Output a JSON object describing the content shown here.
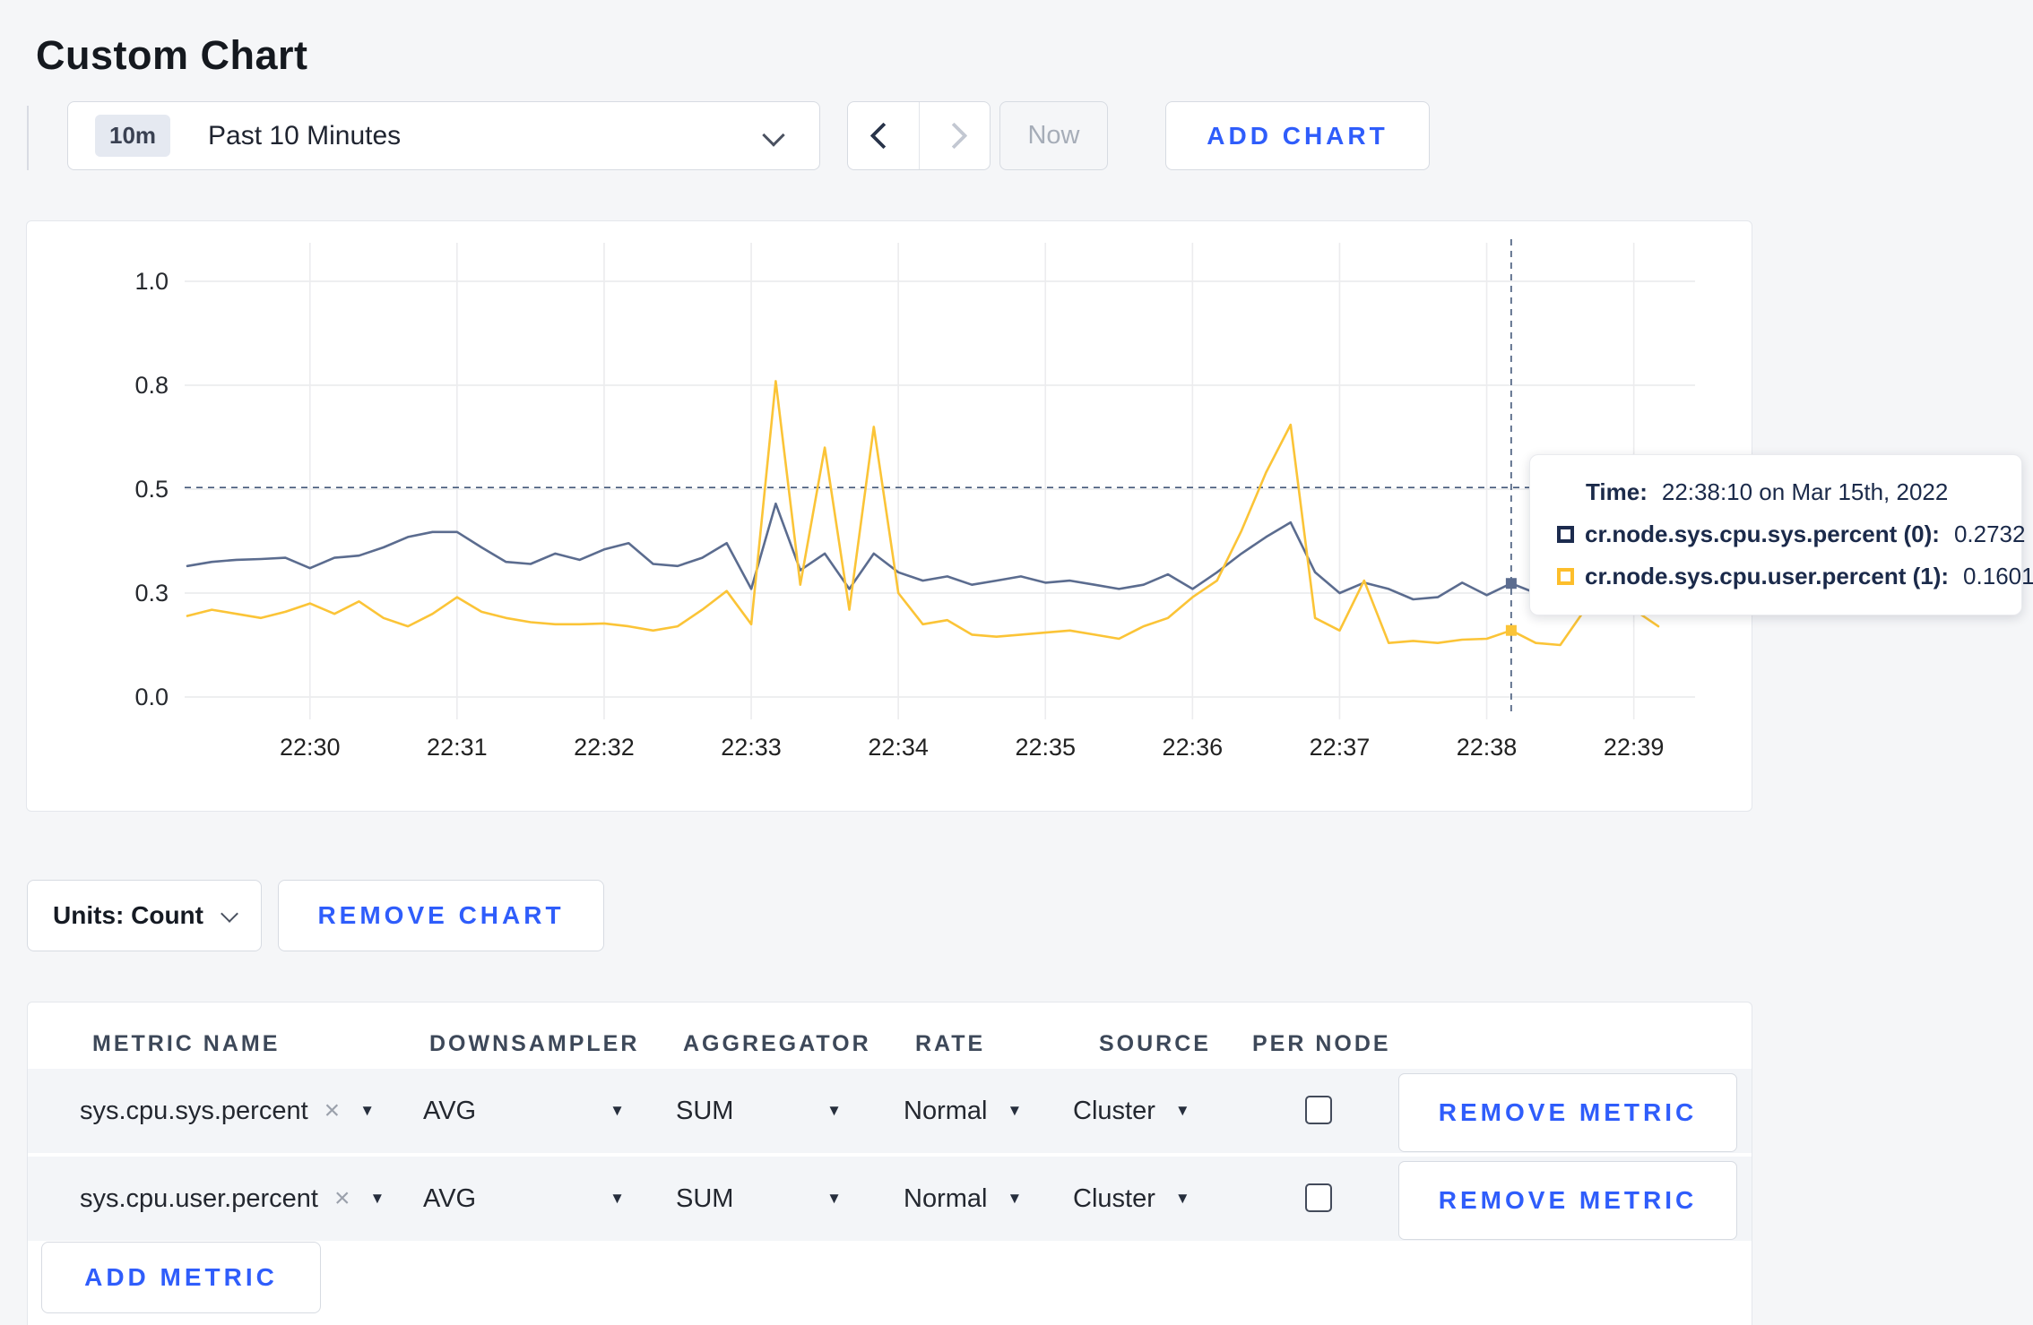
{
  "page": {
    "title": "Custom Chart"
  },
  "toolbar": {
    "time_window_badge": "10m",
    "time_window_label": "Past 10 Minutes",
    "now_label": "Now",
    "add_chart_label": "ADD CHART"
  },
  "chart_data": {
    "type": "line",
    "x_start": "22:29:10",
    "interval_seconds": 10,
    "x_tick_indices": [
      5,
      11,
      17,
      23,
      29,
      35,
      41,
      47,
      53,
      59
    ],
    "x_tick_labels": [
      "22:30",
      "22:31",
      "22:32",
      "22:33",
      "22:34",
      "22:35",
      "22:36",
      "22:37",
      "22:38",
      "22:39"
    ],
    "y_tick_values": [
      0,
      0.25,
      0.5,
      0.75,
      1.0
    ],
    "y_tick_labels": [
      "0.0",
      "0.3",
      "0.5",
      "0.8",
      "1.0"
    ],
    "ylim": [
      0,
      1
    ],
    "grid": true,
    "crosshair": {
      "x_index": 54,
      "time": "22:38:10",
      "y_value": 0.504
    },
    "series": [
      {
        "name": "cr.node.sys.cpu.sys.percent",
        "color": "#5b6c8f",
        "values": [
          0.315,
          0.325,
          0.33,
          0.332,
          0.335,
          0.31,
          0.335,
          0.34,
          0.36,
          0.385,
          0.397,
          0.397,
          0.36,
          0.325,
          0.32,
          0.345,
          0.33,
          0.355,
          0.37,
          0.32,
          0.315,
          0.335,
          0.37,
          0.26,
          0.465,
          0.305,
          0.345,
          0.26,
          0.345,
          0.3,
          0.28,
          0.29,
          0.27,
          0.28,
          0.29,
          0.275,
          0.28,
          0.27,
          0.26,
          0.27,
          0.295,
          0.26,
          0.3,
          0.345,
          0.385,
          0.42,
          0.3,
          0.25,
          0.275,
          0.26,
          0.235,
          0.24,
          0.275,
          0.245,
          0.2732,
          0.25,
          0.26,
          0.27,
          0.275,
          0.27,
          0.265
        ]
      },
      {
        "name": "cr.node.sys.cpu.user.percent",
        "color": "#fbc437",
        "values": [
          0.195,
          0.21,
          0.2,
          0.19,
          0.205,
          0.225,
          0.2,
          0.23,
          0.19,
          0.17,
          0.2,
          0.24,
          0.205,
          0.19,
          0.18,
          0.175,
          0.175,
          0.177,
          0.17,
          0.16,
          0.17,
          0.21,
          0.255,
          0.175,
          0.76,
          0.27,
          0.6,
          0.21,
          0.65,
          0.25,
          0.175,
          0.185,
          0.15,
          0.145,
          0.15,
          0.155,
          0.16,
          0.15,
          0.14,
          0.17,
          0.19,
          0.24,
          0.28,
          0.4,
          0.54,
          0.655,
          0.19,
          0.16,
          0.28,
          0.13,
          0.135,
          0.13,
          0.138,
          0.14,
          0.1601,
          0.13,
          0.125,
          0.21,
          0.26,
          0.21,
          0.17
        ]
      }
    ],
    "markers": [
      {
        "series": 0,
        "x_index": 54,
        "value": 0.2732
      },
      {
        "series": 1,
        "x_index": 54,
        "value": 0.1601
      }
    ]
  },
  "tooltip": {
    "time_label": "Time:",
    "time_value": "22:38:10 on Mar 15th, 2022",
    "series": [
      {
        "name": "cr.node.sys.cpu.sys.percent (0):",
        "value": "0.2732",
        "color": "#1c2b4e"
      },
      {
        "name": "cr.node.sys.cpu.user.percent (1):",
        "value": "0.1601",
        "color": "#fdbe2b"
      }
    ]
  },
  "units_row": {
    "units_label": "Units: Count",
    "remove_chart_label": "REMOVE CHART"
  },
  "metrics_table": {
    "columns": [
      "METRIC NAME",
      "DOWNSAMPLER",
      "AGGREGATOR",
      "RATE",
      "SOURCE",
      "PER NODE"
    ],
    "rows": [
      {
        "metric": "sys.cpu.sys.percent",
        "downsampler": "AVG",
        "aggregator": "SUM",
        "rate": "Normal",
        "source": "Cluster",
        "per_node_checked": false,
        "remove_label": "REMOVE METRIC"
      },
      {
        "metric": "sys.cpu.user.percent",
        "downsampler": "AVG",
        "aggregator": "SUM",
        "rate": "Normal",
        "source": "Cluster",
        "per_node_checked": false,
        "remove_label": "REMOVE METRIC"
      }
    ],
    "add_metric_label": "ADD METRIC",
    "clear_icon": "×",
    "caret_icon": "▼"
  }
}
